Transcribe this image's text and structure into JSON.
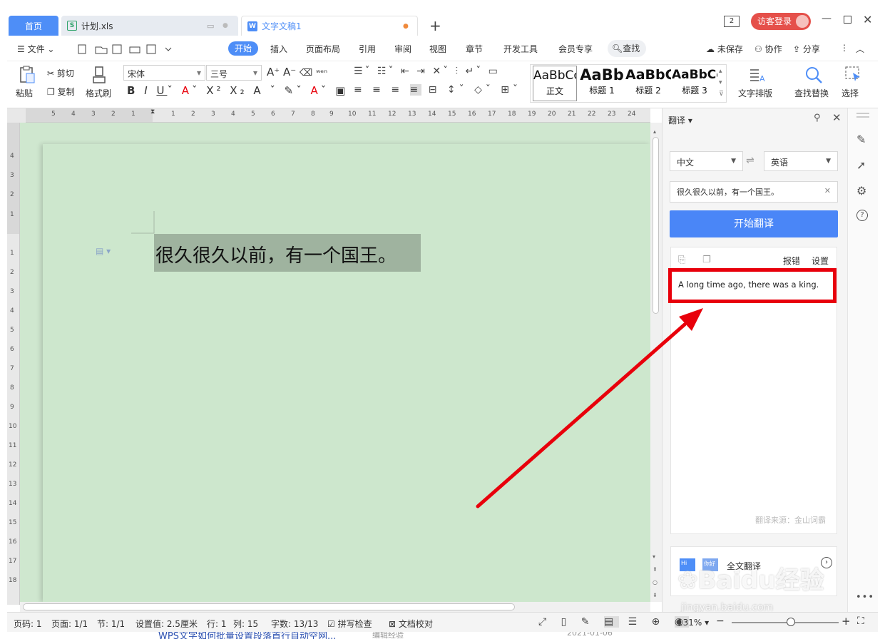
{
  "tabs": {
    "home": "首页",
    "xls": "计划.xls",
    "doc": "文字文稿1",
    "new_tab": "+"
  },
  "title_right": {
    "window_num": "2",
    "login": "访客登录"
  },
  "menu": {
    "file": "文件",
    "items": [
      "开始",
      "插入",
      "页面布局",
      "引用",
      "审阅",
      "视图",
      "章节",
      "开发工具",
      "会员专享"
    ],
    "search": "查找",
    "unsaved": "未保存",
    "collab": "协作",
    "share": "分享"
  },
  "ribbon": {
    "paste": "粘贴",
    "cut": "剪切",
    "copy": "复制",
    "format_painter": "格式刷",
    "font_name": "宋体",
    "font_size": "三号",
    "styles": [
      {
        "preview": "AaBbCcDd",
        "name": "正文"
      },
      {
        "preview": "AaBb",
        "name": "标题 1"
      },
      {
        "preview": "AaBbC",
        "name": "标题 2"
      },
      {
        "preview": "AaBbCcDd",
        "name": "标题 3"
      }
    ],
    "text_layout": "文字排版",
    "find_replace": "查找替换",
    "select": "选择"
  },
  "rulers": {
    "h_left": [
      "5",
      "4",
      "3",
      "2",
      "1"
    ],
    "h_right": [
      "1",
      "2",
      "3",
      "4",
      "5",
      "6",
      "7",
      "8",
      "9",
      "10",
      "11",
      "12",
      "13",
      "14",
      "15",
      "16",
      "17",
      "18",
      "19",
      "20",
      "21",
      "22",
      "23",
      "24"
    ],
    "v_top": [
      "4",
      "3",
      "2",
      "1"
    ],
    "v_bottom": [
      "1",
      "2",
      "3",
      "4",
      "5",
      "6",
      "7",
      "8",
      "9",
      "10",
      "11",
      "12",
      "13",
      "14",
      "15",
      "16",
      "17",
      "18"
    ]
  },
  "document": {
    "text": "很久很久以前，有一个国王。"
  },
  "translate": {
    "title": "翻译",
    "from_lang": "中文",
    "to_lang": "英语",
    "input_text": "很久很久以前，有一个国王。",
    "start_button": "开始翻译",
    "report": "报错",
    "settings": "设置",
    "result": "A long time ago, there was a king.",
    "source": "翻译来源：金山词霸",
    "full_translate": "全文翻译"
  },
  "status": {
    "page_code": "页码: 1",
    "page": "页面: 1/1",
    "section": "节: 1/1",
    "setting": "设置值: 2.5厘米",
    "row": "行: 1",
    "col": "列: 15",
    "word_count": "字数: 13/13",
    "spell_check": "拼写检查",
    "doc_proof": "文档校对",
    "zoom": "131%",
    "zoom_level": 0.55
  },
  "peek": {
    "link_text": "WPS文字如何批量设置段落首行自动空网...",
    "tag": "编辑经验",
    "date": "2021-01-06"
  },
  "watermark": "Baidu经验 jingyan.baidu.com",
  "colors": {
    "accent": "#4e8ef7",
    "doc_bg": "#cde7cd",
    "highlight": "#e8000b",
    "login": "#e5504a"
  }
}
